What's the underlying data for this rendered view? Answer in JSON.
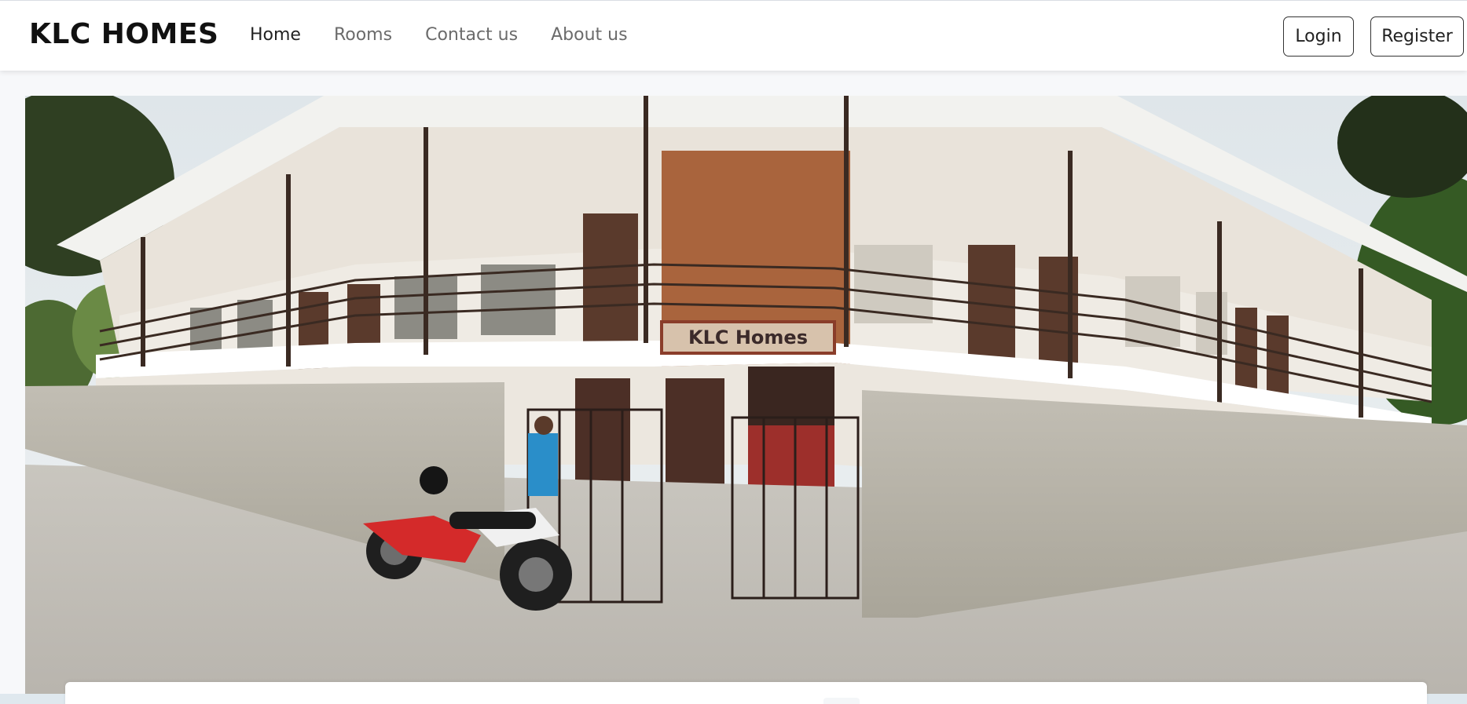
{
  "brand": {
    "name": "KLC HOMES"
  },
  "nav": {
    "items": [
      {
        "label": "Home",
        "active": true
      },
      {
        "label": "Rooms",
        "active": false
      },
      {
        "label": "Contact us",
        "active": false
      },
      {
        "label": "About us",
        "active": false
      }
    ]
  },
  "auth": {
    "login_label": "Login",
    "register_label": "Register"
  },
  "hero": {
    "sign_text": "KLC Homes"
  },
  "colors": {
    "navbar_bg": "#ffffff",
    "page_bg": "#f7f8fa",
    "text_primary": "#111111",
    "text_muted": "#6b6b6b"
  }
}
